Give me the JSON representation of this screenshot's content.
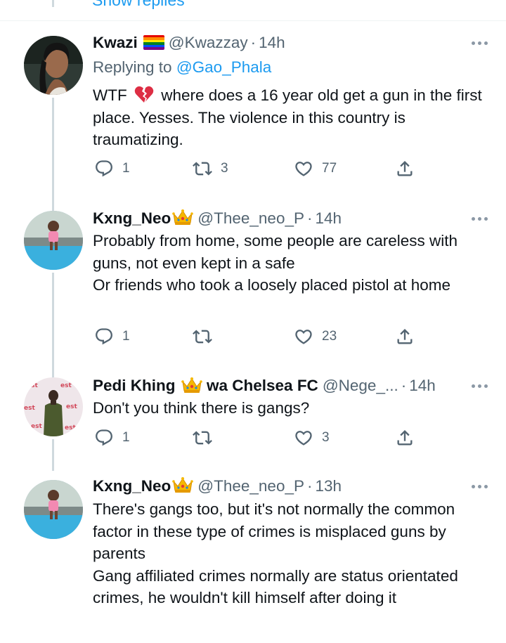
{
  "top": {
    "show_replies": "Show replies"
  },
  "tweets": [
    {
      "name": "Kwazi",
      "handle": "@Kwazzay",
      "sep": "·",
      "time": "14h",
      "replying_prefix": "Replying to ",
      "replying_to": "@Gao_Phala",
      "text_before_emoji": "WTF ",
      "text_after_emoji": " where does a 16 year old get a gun in the first place. Yesses. The violence in this country is traumatizing.",
      "replies": "1",
      "retweets": "3",
      "likes": "77"
    },
    {
      "name": "Kxng_Neo",
      "handle": "@Thee_neo_P",
      "sep": "·",
      "time": "14h",
      "text": "Probably from home, some people are careless with guns, not even kept in a safe\nOr friends who took a loosely placed pistol at home",
      "replies": "1",
      "retweets": "",
      "likes": "23"
    },
    {
      "name_part1": "Pedi Khing ",
      "name_part2": " wa Chelsea FC",
      "handle": "@Nege_...",
      "sep": "·",
      "time": "14h",
      "text": "Don't you think there is gangs?",
      "replies": "1",
      "retweets": "",
      "likes": "3"
    },
    {
      "name": "Kxng_Neo",
      "handle": "@Thee_neo_P",
      "sep": "·",
      "time": "13h",
      "text": "There's gangs too, but it's not normally the common factor in these type of crimes is misplaced guns by parents\nGang affiliated crimes normally are status orientated crimes, he wouldn't kill himself after doing it"
    }
  ],
  "icons": [
    "reply-icon",
    "retweet-icon",
    "like-icon",
    "share-icon",
    "more-icon",
    "crown-emoji",
    "rainbow-flag-emoji",
    "broken-heart-emoji"
  ],
  "colors": {
    "accent": "#1d9bf0",
    "muted": "#536471",
    "text": "#0f1419",
    "thread_line": "#cfd9de"
  }
}
